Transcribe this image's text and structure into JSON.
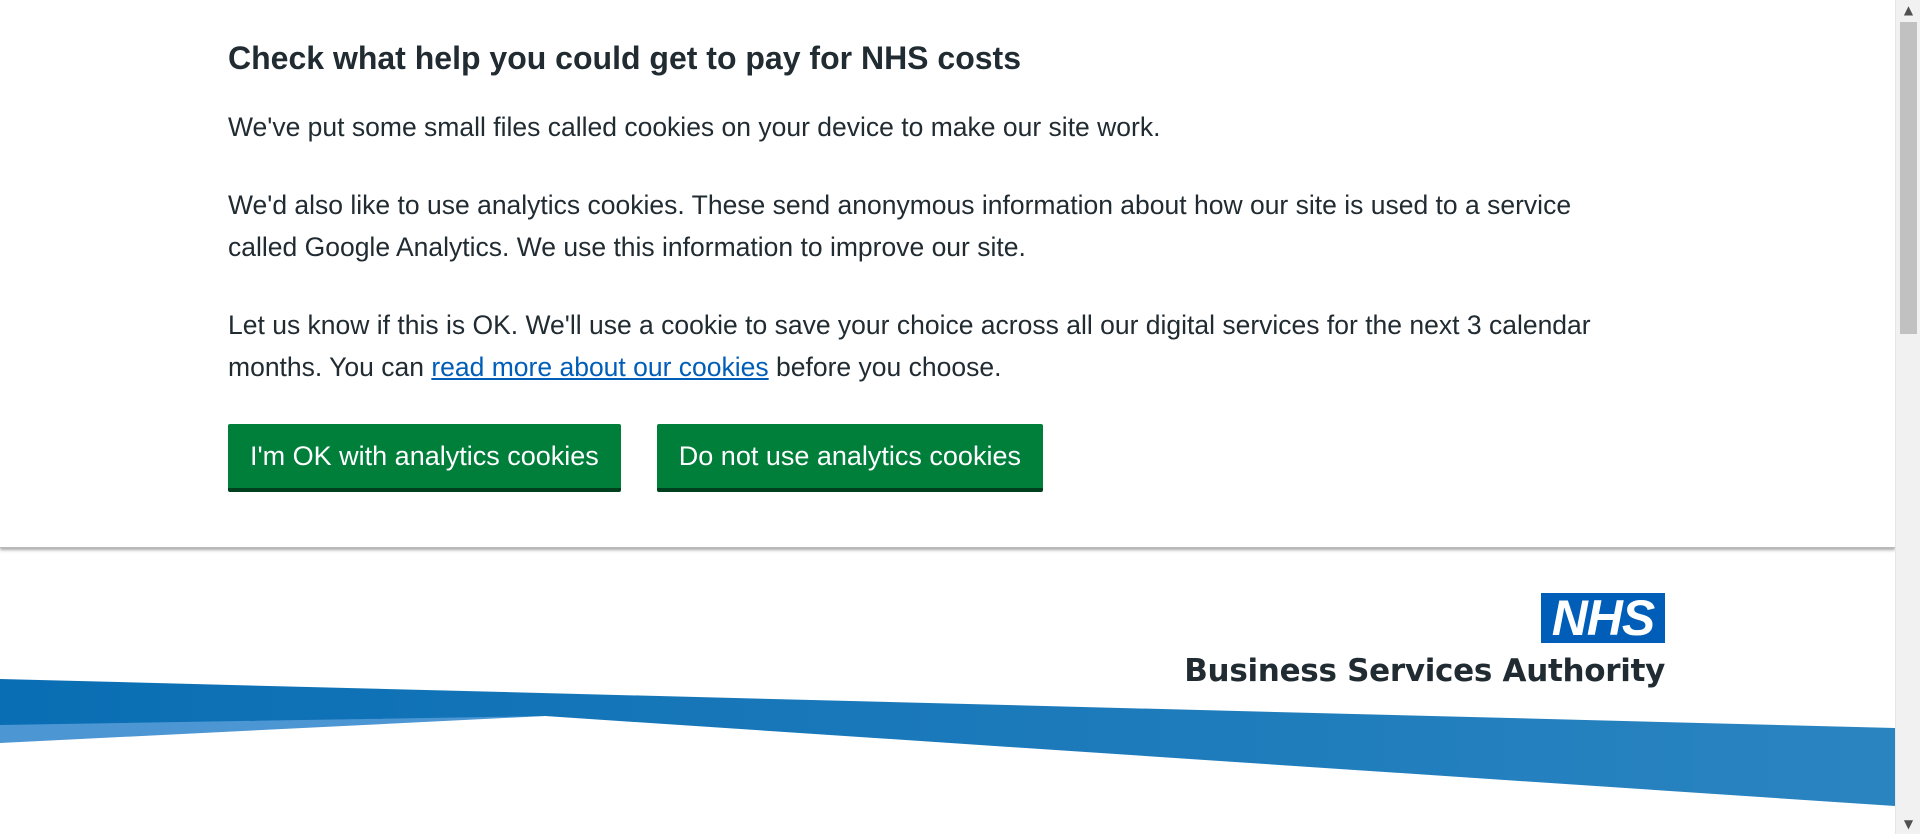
{
  "cookie_banner": {
    "title": "Check what help you could get to pay for NHS costs",
    "paragraph_1": "We've put some small files called cookies on your device to make our site work.",
    "paragraph_2": "We'd also like to use analytics cookies. These send anonymous information about how our site is used to a service called Google Analytics. We use this information to improve our site.",
    "paragraph_3_before": "Let us know if this is OK. We'll use a cookie to save your choice across all our digital services for the next 3 calendar months. You can ",
    "paragraph_3_link": "read more about our cookies",
    "paragraph_3_after": " before you choose.",
    "accept_button": "I'm OK with analytics cookies",
    "reject_button": "Do not use analytics cookies"
  },
  "header": {
    "logo_text": "NHS",
    "org_name": "Business Services Authority"
  },
  "scrollbar": {
    "up_icon": "chevron-up-icon",
    "down_icon": "chevron-down-icon"
  },
  "colors": {
    "button_green": "#007f3b",
    "nhs_blue": "#005eb8",
    "link_blue": "#005eb8",
    "text": "#212b32",
    "swoosh_dark": "#1874b8",
    "swoosh_light": "#4b96d3"
  }
}
